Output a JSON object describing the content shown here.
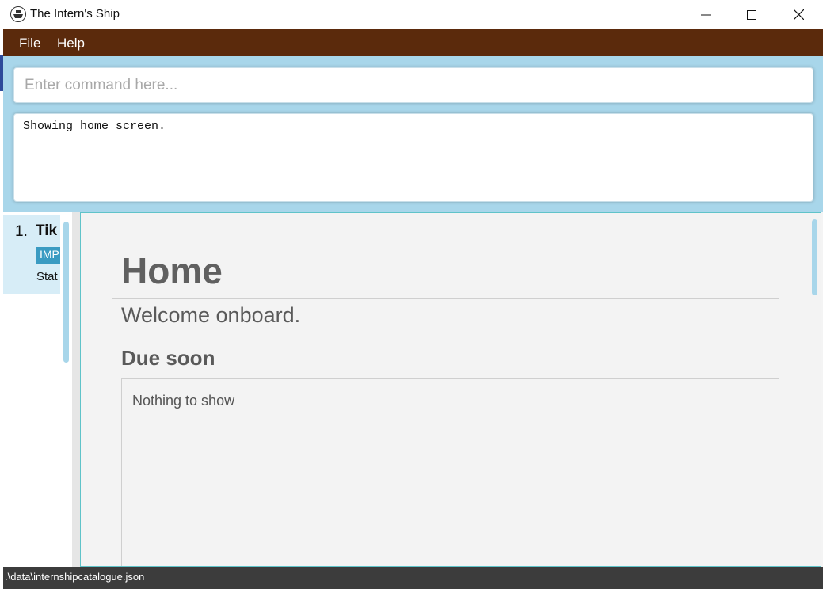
{
  "window": {
    "title": "The Intern's Ship"
  },
  "menu": {
    "file": "File",
    "help": "Help"
  },
  "command": {
    "placeholder": "Enter command here...",
    "value": ""
  },
  "result": {
    "text": "Showing home screen."
  },
  "list": {
    "items": [
      {
        "index": "1.",
        "name": "Tik",
        "tag": "IMP",
        "status": "Stat"
      }
    ]
  },
  "home": {
    "title": "Home",
    "welcome": "Welcome onboard.",
    "due_title": "Due soon",
    "due_empty": "Nothing to show"
  },
  "status_bar": {
    "path": ".\\data\\internshipcatalogue.json"
  },
  "colors": {
    "menubar": "#5b2a0c",
    "background": "#a8d6ea",
    "tag": "#3a9bc2",
    "status_bar": "#3c3c3c"
  }
}
